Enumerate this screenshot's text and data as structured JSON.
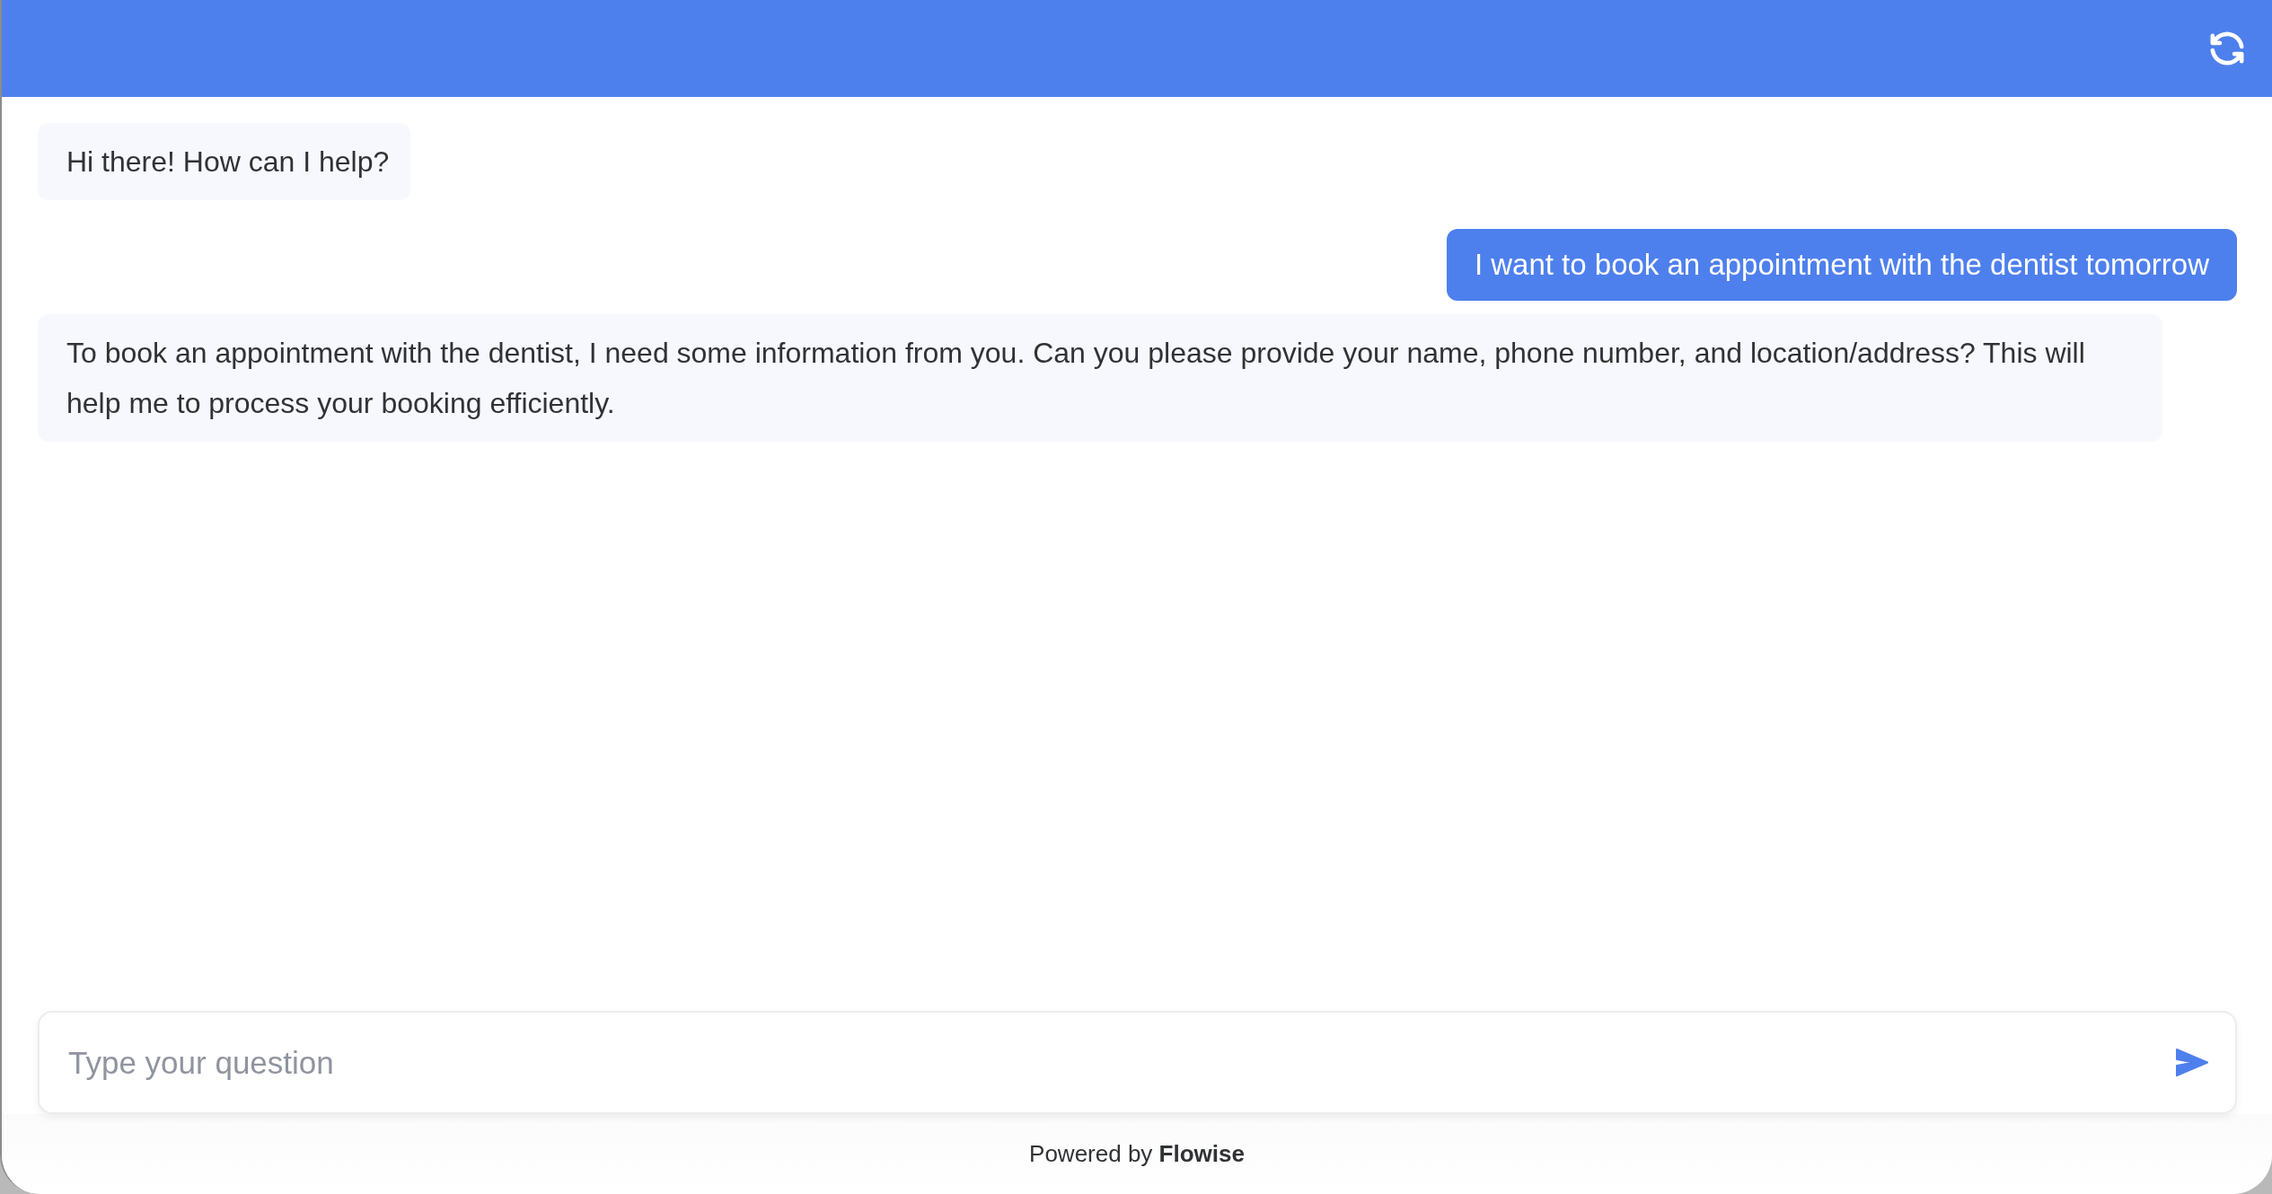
{
  "messages": [
    {
      "kind": "bot",
      "text": "Hi there! How can I help?"
    },
    {
      "kind": "user",
      "text": "I want to book an appointment with the dentist tomorrow"
    },
    {
      "kind": "bot",
      "text": "To book an appointment with the dentist, I need some information from you. Can you please provide your name, phone number, and location/address? This will help me to process your booking efficiently."
    }
  ],
  "input": {
    "placeholder": "Type your question"
  },
  "footer": {
    "text": "Powered by **Flowise**"
  }
}
